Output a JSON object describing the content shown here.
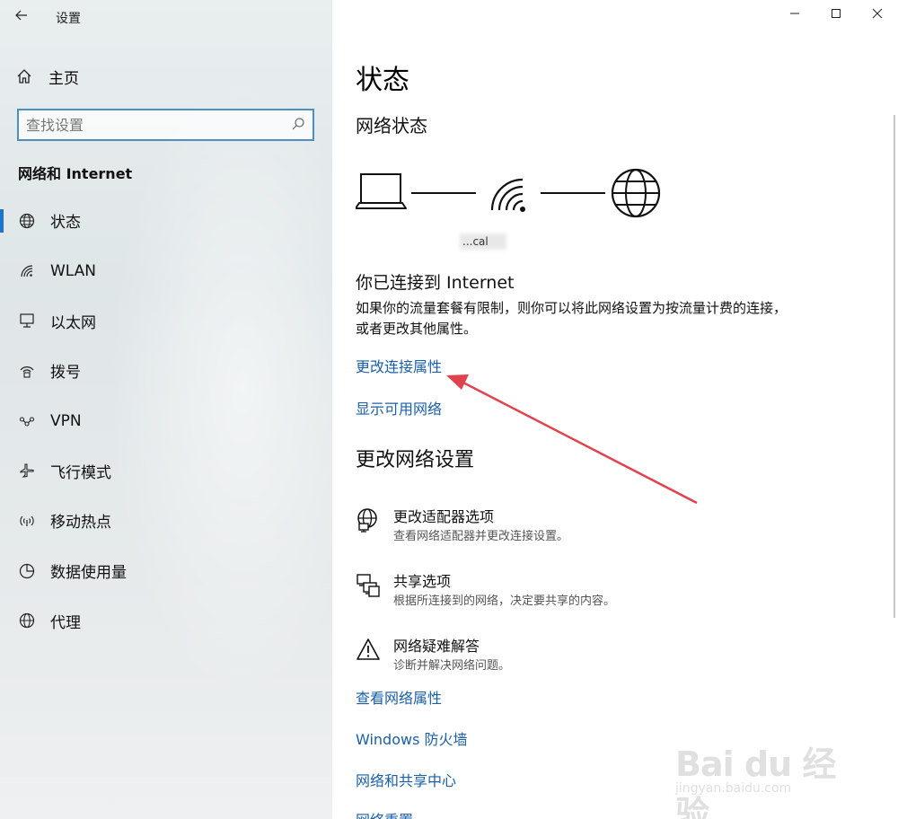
{
  "window": {
    "title": "设置",
    "controls": {
      "minimize": "minimize",
      "maximize": "maximize",
      "close": "close"
    }
  },
  "sidebar": {
    "home_label": "主页",
    "search_placeholder": "查找设置",
    "section_title": "网络和 Internet",
    "items": [
      {
        "label": "状态",
        "icon": "globe-icon",
        "active": true
      },
      {
        "label": "WLAN",
        "icon": "wifi-icon",
        "active": false
      },
      {
        "label": "以太网",
        "icon": "ethernet-icon",
        "active": false
      },
      {
        "label": "拨号",
        "icon": "dialup-icon",
        "active": false
      },
      {
        "label": "VPN",
        "icon": "vpn-icon",
        "active": false
      },
      {
        "label": "飞行模式",
        "icon": "airplane-icon",
        "active": false
      },
      {
        "label": "移动热点",
        "icon": "hotspot-icon",
        "active": false
      },
      {
        "label": "数据使用量",
        "icon": "data-usage-icon",
        "active": false
      },
      {
        "label": "代理",
        "icon": "proxy-globe-icon",
        "active": false
      }
    ]
  },
  "main": {
    "title": "状态",
    "network_status_heading": "网络状态",
    "network_name": "...cal",
    "connected_heading": "你已连接到 Internet",
    "description": "如果你的流量套餐有限制，则你可以将此网络设置为按流量计费的连接，或者更改其他属性。",
    "links": {
      "change_connection_properties": "更改连接属性",
      "show_available_networks": "显示可用网络"
    },
    "change_settings_heading": "更改网络设置",
    "options": [
      {
        "title": "更改适配器选项",
        "subtitle": "查看网络适配器并更改连接设置。",
        "icon": "adapter-icon"
      },
      {
        "title": "共享选项",
        "subtitle": "根据所连接到的网络，决定要共享的内容。",
        "icon": "sharing-icon"
      },
      {
        "title": "网络疑难解答",
        "subtitle": "诊断并解决网络问题。",
        "icon": "warning-icon"
      }
    ],
    "bottom_links": {
      "view_network_properties": "查看网络属性",
      "windows_firewall": "Windows 防火墙",
      "network_sharing_center": "网络和共享中心",
      "network_reset": "网络重置"
    }
  },
  "watermark": {
    "brand": "Bai du 经验",
    "url": "jingyan.baidu.com"
  },
  "colors": {
    "accent": "#1f73c8",
    "link": "#1a5fa8",
    "annotation_arrow": "#e0434d"
  }
}
